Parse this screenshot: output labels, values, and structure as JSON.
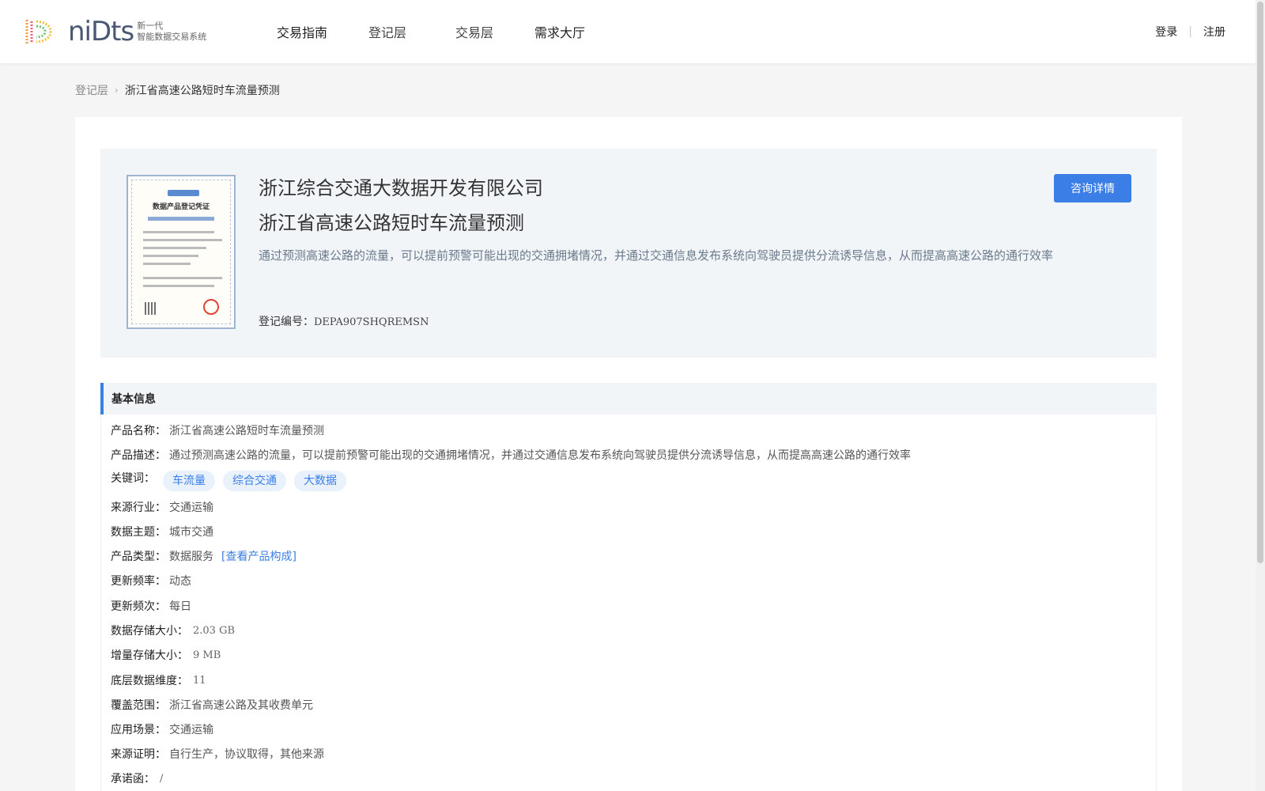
{
  "header": {
    "logo_word": "niDts",
    "logo_sub1": "新一代",
    "logo_sub2": "智能数据交易系统",
    "nav": [
      "交易指南",
      "登记层",
      "交易层",
      "需求大厅"
    ],
    "login": "登录",
    "register": "注册",
    "separator": "|"
  },
  "breadcrumb": {
    "parent": "登记层",
    "separator": "›",
    "current": "浙江省高速公路短时车流量预测"
  },
  "summary": {
    "certificate_title": "数据产品登记凭证",
    "company": "浙江综合交通大数据开发有限公司",
    "title": "浙江省高速公路短时车流量预测",
    "description": "通过预测高速公路的流量，可以提前预警可能出现的交通拥堵情况，并通过交通信息发布系统向驾驶员提供分流诱导信息，从而提高高速公路的通行效率",
    "reg_label": "登记编号：",
    "reg_value": "DEPA907SHQREMSN",
    "consult_button": "咨询详情"
  },
  "basic_info": {
    "title": "基本信息",
    "product_name_label": "产品名称：",
    "product_name": "浙江省高速公路短时车流量预测",
    "product_desc_label": "产品描述：",
    "product_desc": "通过预测高速公路的流量，可以提前预警可能出现的交通拥堵情况，并通过交通信息发布系统向驾驶员提供分流诱导信息，从而提高高速公路的通行效率",
    "keywords_label": "关键词：",
    "keywords": [
      "车流量",
      "综合交通",
      "大数据"
    ],
    "industry_label": "来源行业：",
    "industry": "交通运输",
    "topic_label": "数据主题：",
    "topic": "城市交通",
    "type_label": "产品类型：",
    "type": "数据服务",
    "type_link": "[查看产品构成]",
    "update_freq_label": "更新频率：",
    "update_freq": "动态",
    "update_times_label": "更新频次：",
    "update_times": "每日",
    "storage_label": "数据存储大小：",
    "storage": "2.03 GB",
    "increment_label": "增量存储大小：",
    "increment": "9 MB",
    "dimension_label": "底层数据维度：",
    "dimension": "11",
    "coverage_label": "覆盖范围：",
    "coverage": "浙江省高速公路及其收费单元",
    "scenario_label": "应用场景：",
    "scenario": "交通运输",
    "source_label": "来源证明：",
    "source": "自行生产，协议取得，其他来源",
    "commitment_label": "承诺函：",
    "commitment": "/"
  },
  "colors": {
    "accent": "#3a7ee6",
    "panel": "#f2f5f8"
  }
}
